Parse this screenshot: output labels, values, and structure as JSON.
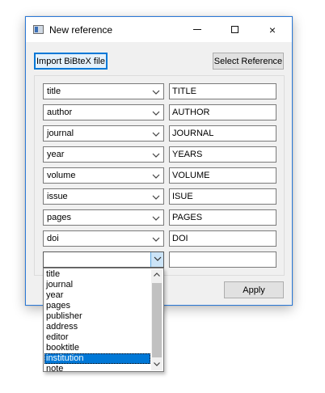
{
  "window": {
    "title": "New reference",
    "controls": {
      "minimize": "minimize",
      "maximize": "maximize",
      "close": "×"
    }
  },
  "toolbar": {
    "import_label": "Import BiBteX file",
    "select_label": "Select Reference"
  },
  "rows": [
    {
      "field": "title",
      "value": "TITLE"
    },
    {
      "field": "author",
      "value": "AUTHOR"
    },
    {
      "field": "journal",
      "value": "JOURNAL"
    },
    {
      "field": "year",
      "value": "YEARS"
    },
    {
      "field": "volume",
      "value": "VOLUME"
    },
    {
      "field": "issue",
      "value": "ISUE"
    },
    {
      "field": "pages",
      "value": "PAGES"
    },
    {
      "field": "doi",
      "value": "DOI"
    },
    {
      "field": "",
      "value": ""
    }
  ],
  "dropdown": {
    "options": [
      "title",
      "journal",
      "year",
      "pages",
      "publisher",
      "address",
      "editor",
      "booktitle",
      "institution",
      "note"
    ],
    "highlighted": "institution"
  },
  "footer": {
    "apply_label": "Apply"
  },
  "colors": {
    "accent": "#0078d7",
    "window_border": "#2b79d7",
    "dialog_bg": "#f0f0f0"
  }
}
